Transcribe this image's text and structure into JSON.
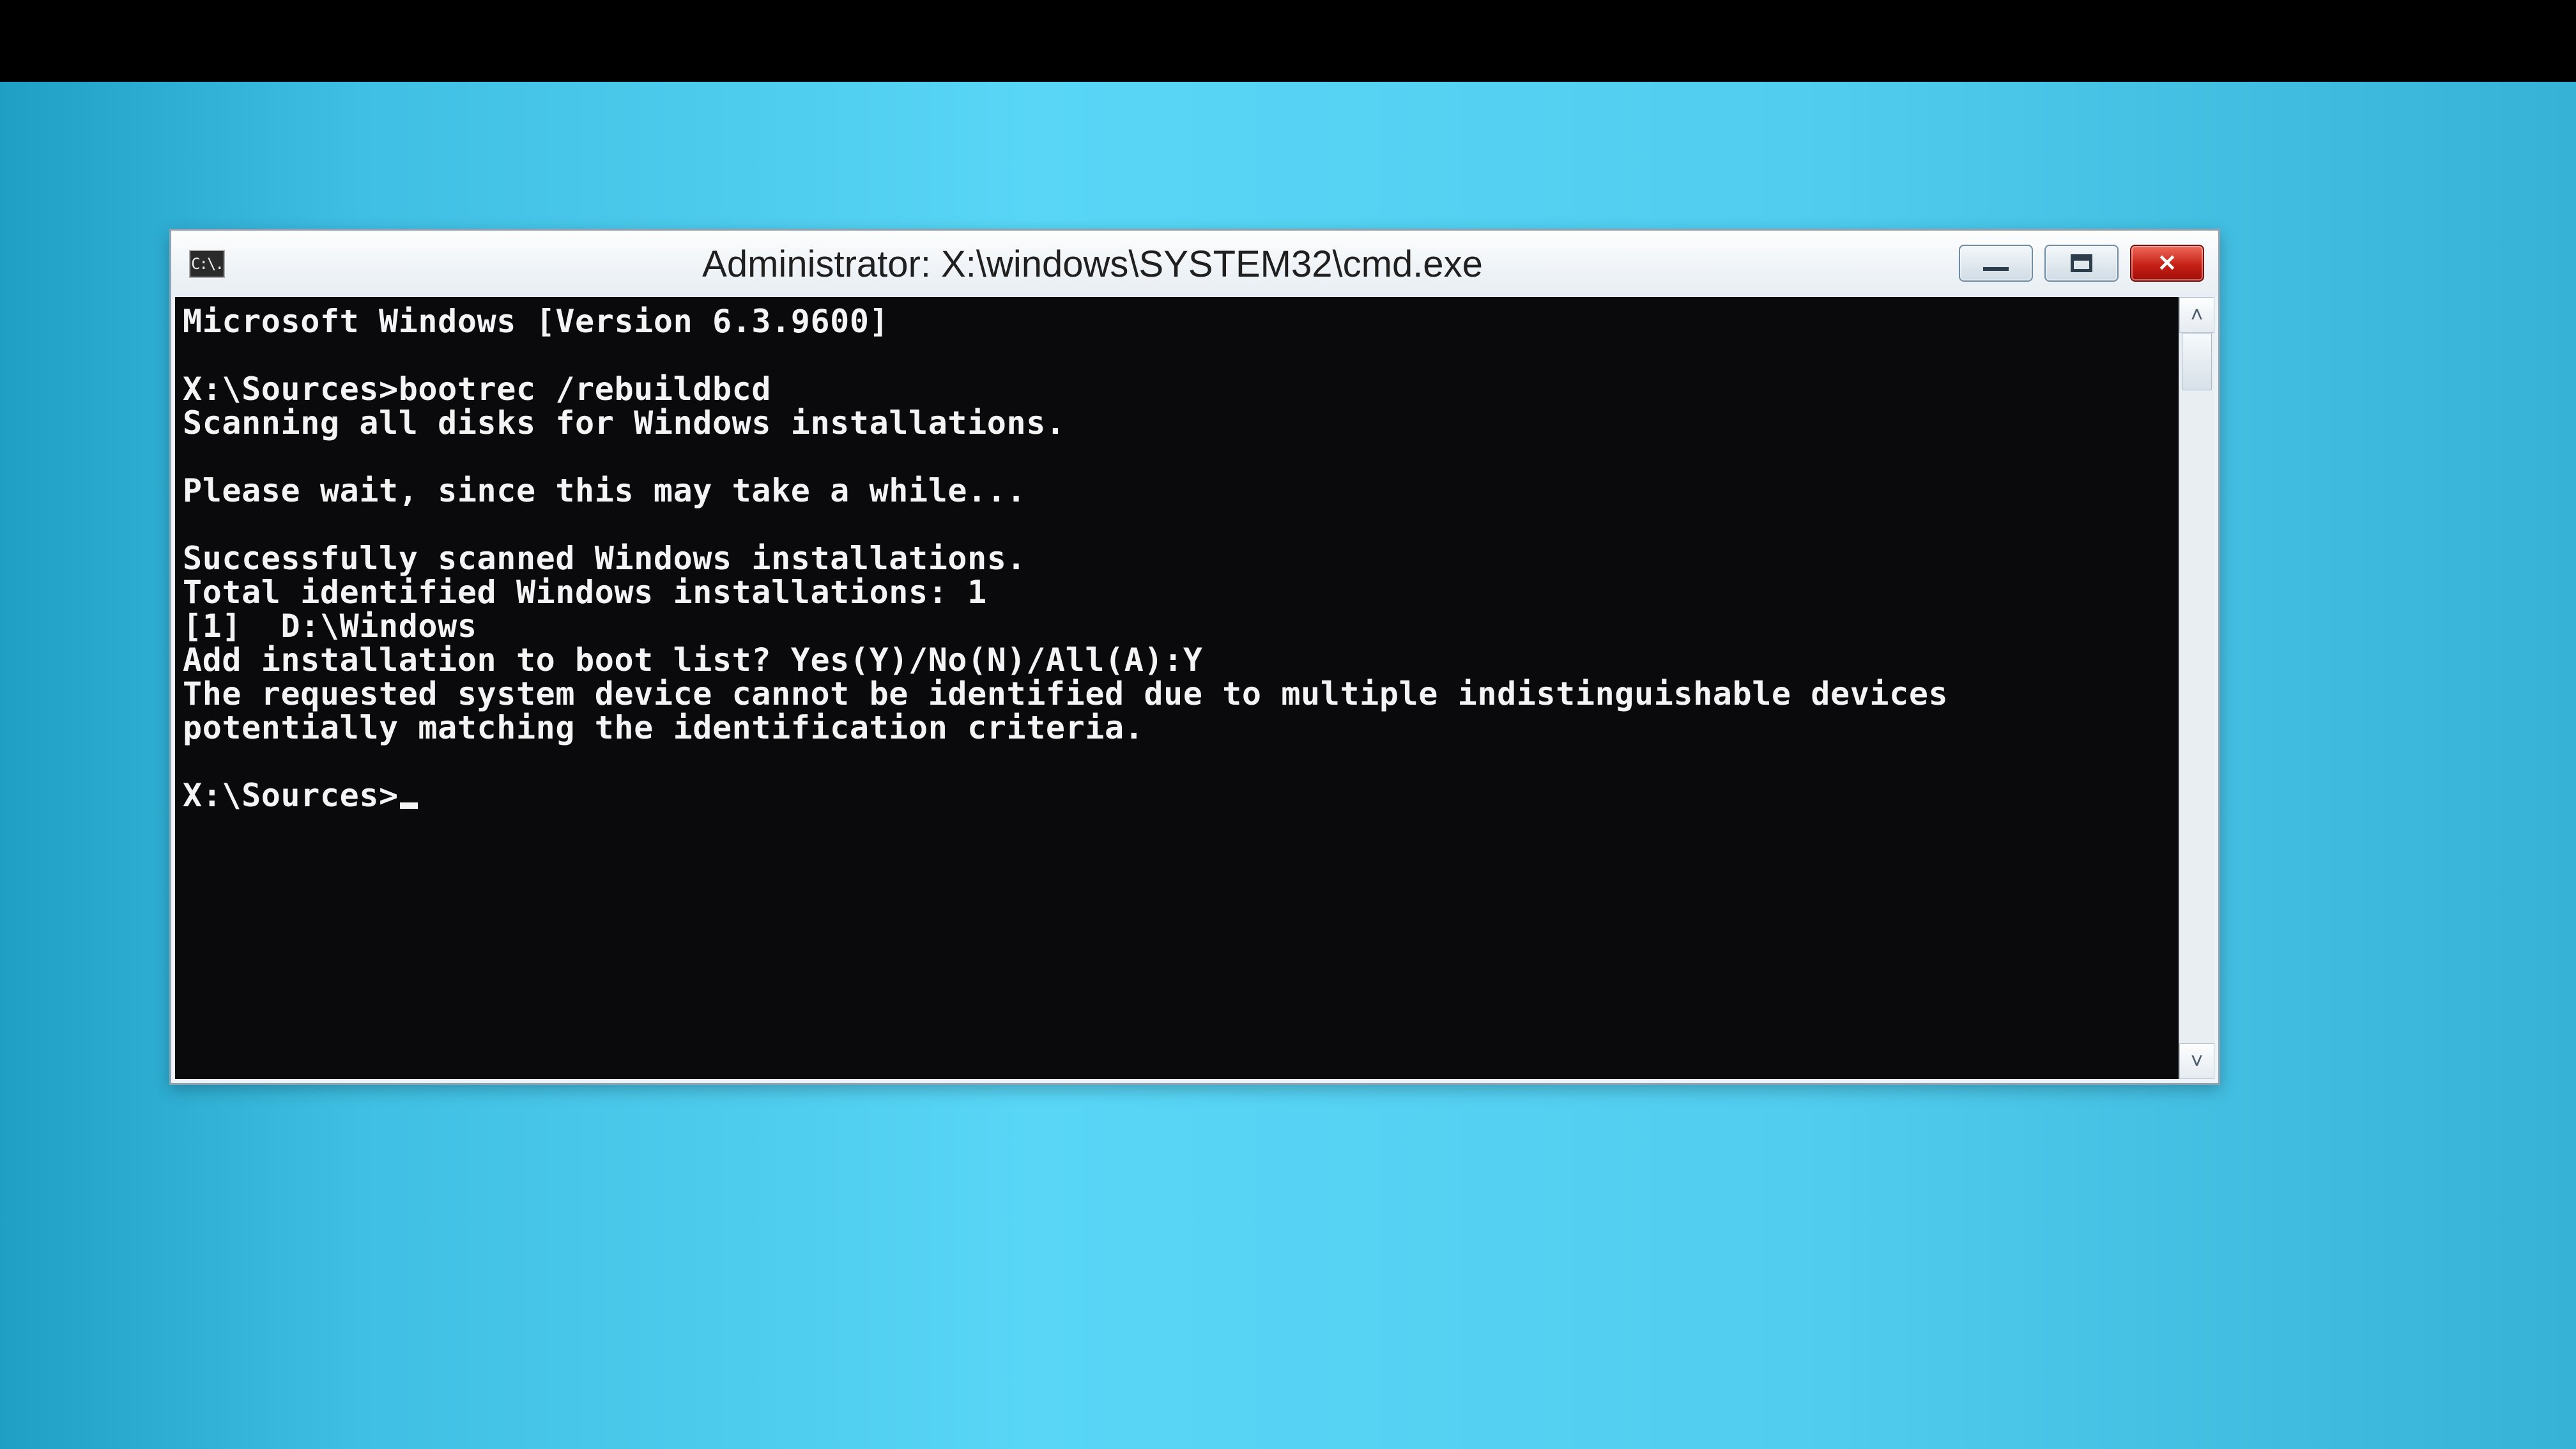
{
  "window": {
    "title": "Administrator: X:\\windows\\SYSTEM32\\cmd.exe",
    "app_icon_text": "C:\\."
  },
  "console": {
    "version_line": "Microsoft Windows [Version 6.3.9600]",
    "blank1": "",
    "prompt1": "X:\\Sources>",
    "command1": "bootrec /rebuildbcd",
    "scan_line": "Scanning all disks for Windows installations.",
    "blank2": "",
    "wait_line": "Please wait, since this may take a while...",
    "blank3": "",
    "success_line": "Successfully scanned Windows installations.",
    "total_line": "Total identified Windows installations: 1",
    "entry_line": "[1]  D:\\Windows",
    "ask_line": "Add installation to boot list? Yes(Y)/No(N)/All(A):Y",
    "error_line": "The requested system device cannot be identified due to multiple indistinguishable devices potentially matching the identification criteria.",
    "blank4": "",
    "prompt2": "X:\\Sources>"
  }
}
